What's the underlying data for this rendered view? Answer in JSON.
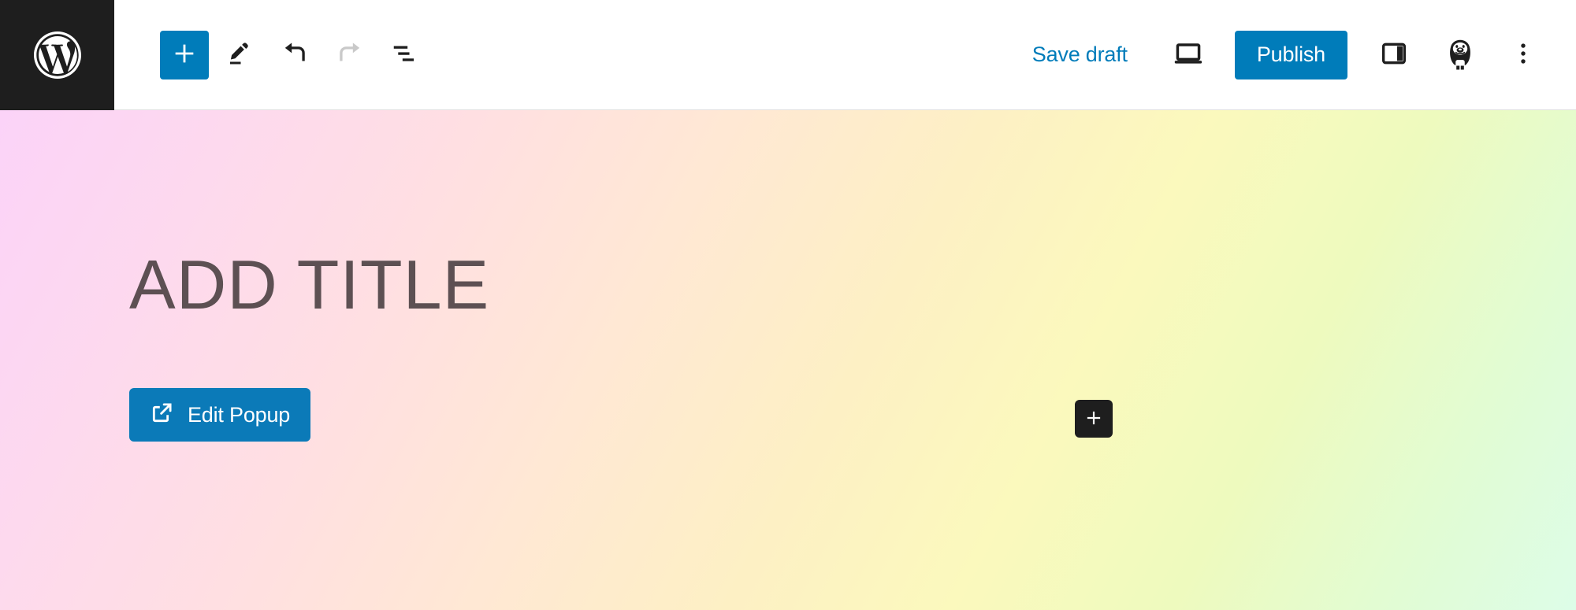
{
  "app": {
    "name": "WordPress Block Editor",
    "logo_icon": "wordpress-logo-icon"
  },
  "toolbar": {
    "left": [
      {
        "id": "add-block",
        "label": "Toggle block inserter",
        "icon": "plus-icon",
        "state": "primary"
      },
      {
        "id": "tools",
        "label": "Tools",
        "icon": "pencil-icon",
        "state": "enabled"
      },
      {
        "id": "undo",
        "label": "Undo",
        "icon": "undo-arrow-icon",
        "state": "enabled"
      },
      {
        "id": "redo",
        "label": "Redo",
        "icon": "redo-arrow-icon",
        "state": "disabled"
      },
      {
        "id": "list-view",
        "label": "Document Overview",
        "icon": "list-view-icon",
        "state": "enabled"
      }
    ],
    "save_draft_label": "Save draft",
    "preview_label": "Preview",
    "preview_icon": "laptop-icon",
    "publish_label": "Publish",
    "settings_label": "Settings",
    "settings_icon": "sidebar-panel-icon",
    "plugin_label": "Plugin",
    "plugin_icon": "gorilla-mascot-icon",
    "more_label": "Options",
    "more_icon": "three-dots-vertical-icon"
  },
  "canvas": {
    "title": "ADD TITLE",
    "edit_popup": {
      "label": "Edit Popup",
      "icon": "external-link-icon"
    },
    "add_block_fab": {
      "label": "Add block",
      "icon": "plus-icon"
    }
  },
  "colors": {
    "accent_blue": "#007cba",
    "button_blue": "#0b7ab8",
    "dark": "#1e1e1e",
    "title_text": "#5d5053",
    "gradient_start": "#fbd3f8",
    "gradient_mid": "#fbf9bd",
    "gradient_end": "#ddfde8"
  }
}
